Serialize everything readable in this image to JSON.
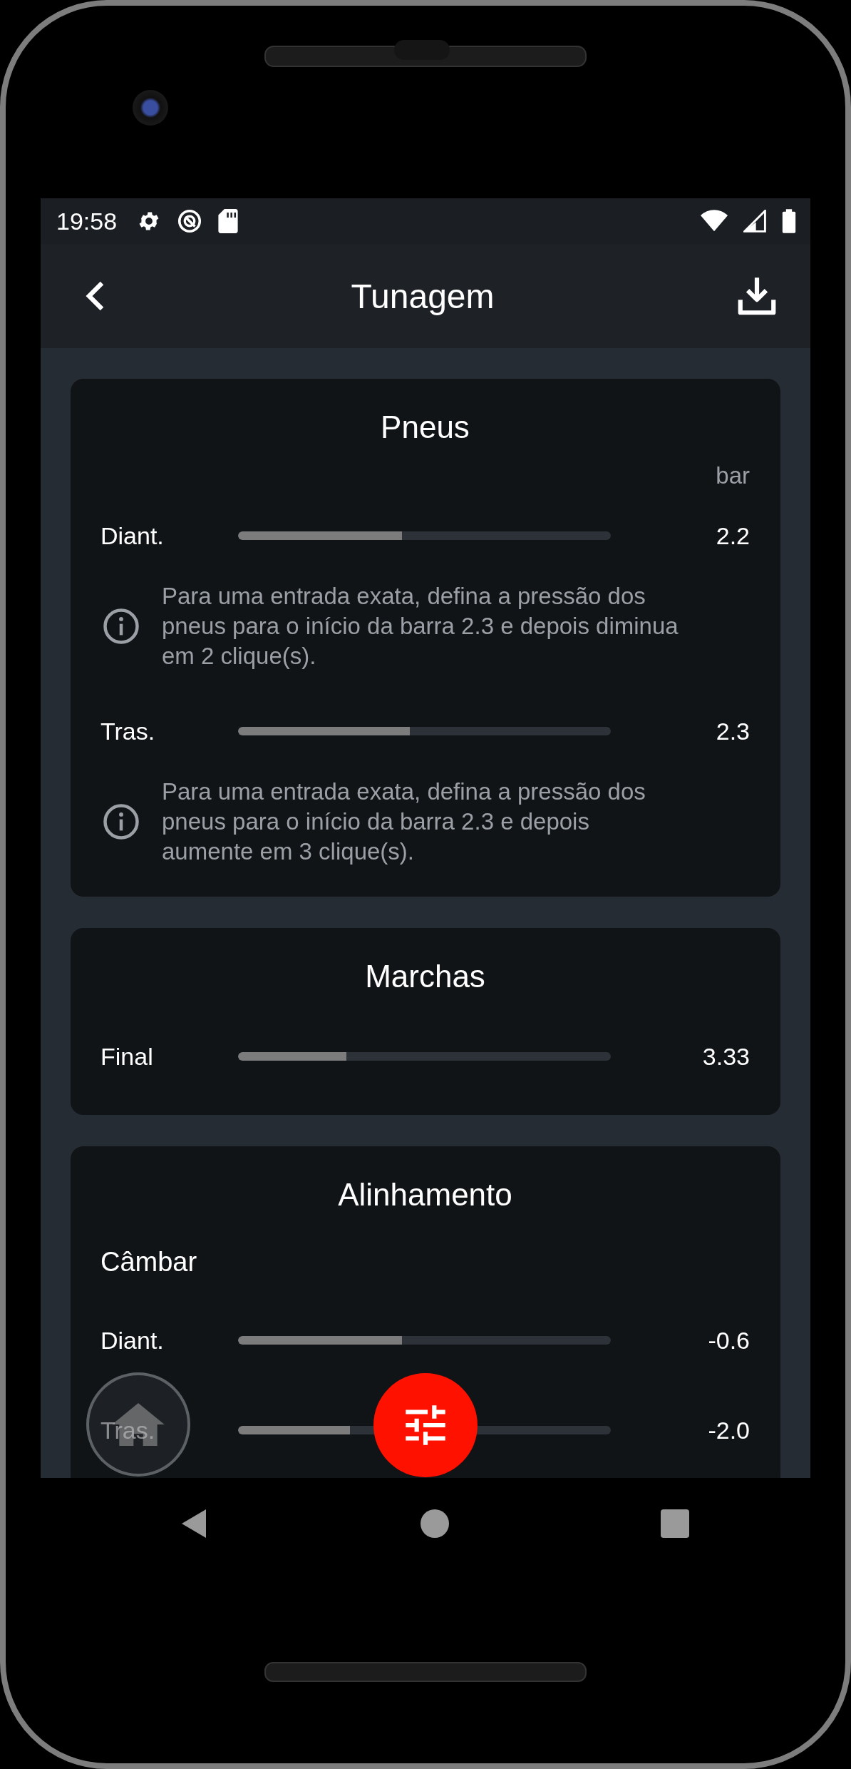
{
  "status_bar": {
    "time": "19:58"
  },
  "app_bar": {
    "title": "Tunagem"
  },
  "sections": [
    {
      "title": "Pneus",
      "unit": "bar",
      "rows": [
        {
          "kind": "slider",
          "label": "Diant.",
          "level": 0.44,
          "value": "2.2"
        },
        {
          "kind": "info",
          "text": "Para uma entrada exata, defina a pressão dos pneus para o início da barra 2.3 e depois diminua em 2 clique(s)."
        },
        {
          "kind": "slider",
          "label": "Tras.",
          "level": 0.46,
          "value": "2.3"
        },
        {
          "kind": "info",
          "text": "Para uma entrada exata, defina a pressão dos pneus para o início da barra 2.3 e depois aumente em 3 clique(s)."
        }
      ]
    },
    {
      "title": "Marchas",
      "rows": [
        {
          "kind": "slider",
          "label": "Final",
          "level": 0.29,
          "value": "3.33"
        }
      ]
    },
    {
      "title": "Alinhamento",
      "rows": [
        {
          "kind": "subheading",
          "text": "Câmbar"
        },
        {
          "kind": "slider",
          "label": "Diant.",
          "level": 0.44,
          "value": "-0.6"
        },
        {
          "kind": "slider",
          "label": "Tras.",
          "level": 0.3,
          "value": "-2.0"
        }
      ]
    }
  ]
}
